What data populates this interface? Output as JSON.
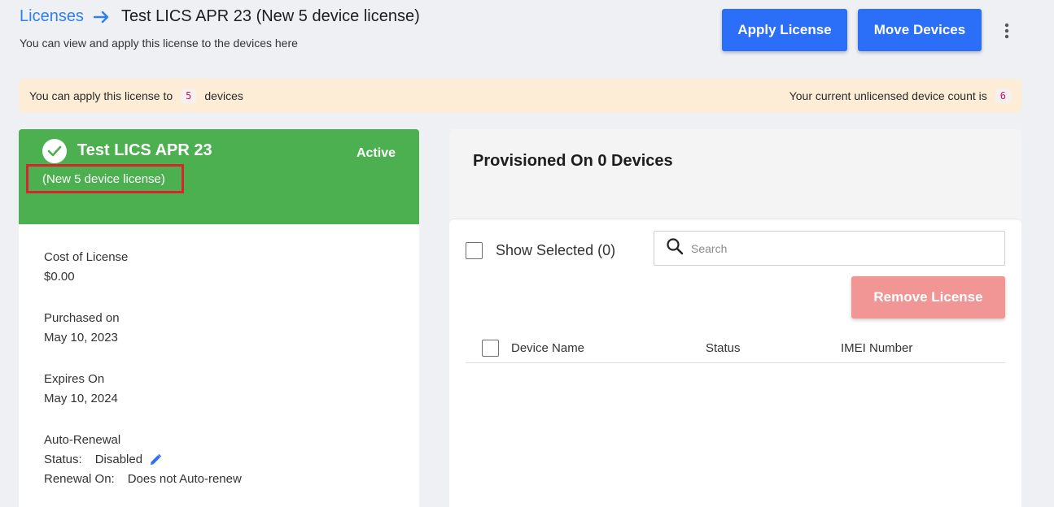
{
  "header": {
    "breadcrumb_link": "Licenses",
    "breadcrumb_current": "Test LICS APR 23 (New 5 device license)",
    "subtitle": "You can view and apply this license to the devices here"
  },
  "actions": {
    "apply_license": "Apply License",
    "move_devices": "Move Devices"
  },
  "banner": {
    "apply_prefix": "You can apply this license to",
    "apply_count": "5",
    "apply_suffix": "devices",
    "unlicensed_label": "Your current unlicensed device count is",
    "unlicensed_count": "6"
  },
  "license": {
    "title": "Test LICS APR 23",
    "subtitle": "(New 5 device license)",
    "status": "Active",
    "cost_label": "Cost of License",
    "cost_value": "$0.00",
    "purchased_label": "Purchased on",
    "purchased_value": "May 10, 2023",
    "expires_label": "Expires On",
    "expires_value": "May 10, 2024",
    "auto_renewal_label": "Auto-Renewal",
    "status_key": "Status:",
    "status_value": "Disabled",
    "renewal_key": "Renewal On:",
    "renewal_value": "Does not Auto-renew"
  },
  "devices": {
    "title": "Provisioned On 0 Devices",
    "show_selected": "Show Selected (0)",
    "search_placeholder": "Search",
    "remove_license": "Remove License",
    "columns": [
      "Device Name",
      "Status",
      "IMEI Number"
    ]
  },
  "colors": {
    "primary": "#2b6ef7",
    "success": "#4caf50",
    "danger_soft": "#f29595",
    "banner": "#fdecd6",
    "highlight": "#d9232d"
  }
}
